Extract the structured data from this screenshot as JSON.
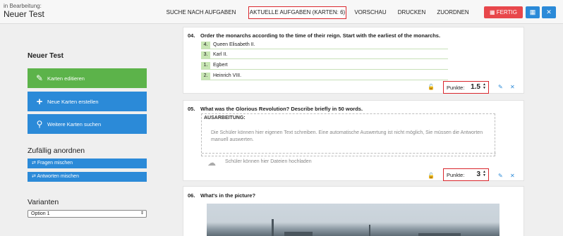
{
  "header": {
    "editing_label": "in Bearbeitung:",
    "test_title": "Neuer Test",
    "tabs": [
      {
        "label": "SUCHE NACH AUFGABEN",
        "active": false
      },
      {
        "label": "AKTUELLE AUFGABEN (KARTEN: 6)",
        "active": true
      },
      {
        "label": "VORSCHAU",
        "active": false
      },
      {
        "label": "DRUCKEN",
        "active": false
      },
      {
        "label": "ZUORDNEN",
        "active": false
      }
    ],
    "finish_label": "FERTIG",
    "save_icon": "floppy-disk-icon",
    "close_icon": "close-icon"
  },
  "sidebar": {
    "title": "Neuer Test",
    "buttons": [
      {
        "label": "Karten editieren",
        "icon": "edit-icon"
      },
      {
        "label": "Neue Karten erstellen",
        "icon": "plus-icon"
      },
      {
        "label": "Weitere Karten suchen",
        "icon": "search-icon"
      }
    ],
    "shuffle_heading": "Zufällig anordnen",
    "shuffle_buttons": [
      {
        "label": "Fragen mischen",
        "icon": "shuffle-icon"
      },
      {
        "label": "Antworten mischen",
        "icon": "shuffle-icon"
      }
    ],
    "variants_heading": "Varianten",
    "variant_select": "Option 1"
  },
  "cards": [
    {
      "number": "04.",
      "question": "Order the monarchs according to the time of their reign. Start with the earliest of the monarchs.",
      "items": [
        {
          "index": "4.",
          "text": "Queen Elisabeth II."
        },
        {
          "index": "3.",
          "text": "Karl II."
        },
        {
          "index": "1.",
          "text": "Egbert"
        },
        {
          "index": "2.",
          "text": "Heinrich VIII."
        }
      ],
      "points_label": "Punkte:",
      "points_value": "1.5"
    },
    {
      "number": "05.",
      "question": "What was the Glorious Revolution? Describe briefly in 50 words.",
      "answer_label": "AUSARBEITUNG:",
      "answer_desc": "Die Schüler können hier eigenen Text schreiben. Eine automatische Auswertung ist nicht möglich, Sie müssen die Antworten manuell auswerten.",
      "upload_text": "Schüler können hier Dateien hochladen",
      "points_label": "Punkte:",
      "points_value": "3"
    },
    {
      "number": "06.",
      "question": "What's in the picture?"
    }
  ],
  "colors": {
    "accent_blue": "#2b8ad8",
    "accent_green": "#5cb34a",
    "danger_red": "#e8474b",
    "highlight_border": "#d9262c"
  }
}
